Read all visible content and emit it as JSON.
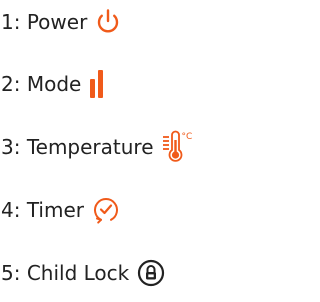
{
  "accent_color": "#f05a1a",
  "legend": {
    "items": [
      {
        "number": "1",
        "label": "Power",
        "text": "1: Power",
        "icon": "power-icon"
      },
      {
        "number": "2",
        "label": "Mode",
        "text": "2: Mode",
        "icon": "mode-bars-icon"
      },
      {
        "number": "3",
        "label": "Temperature",
        "text": "3: Temperature",
        "icon": "thermometer-icon",
        "icon_text": "°C"
      },
      {
        "number": "4",
        "label": "Timer",
        "text": "4: Timer",
        "icon": "timer-icon"
      },
      {
        "number": "5",
        "label": "Child Lock",
        "text": "5: Child Lock",
        "icon": "child-lock-icon"
      }
    ]
  }
}
